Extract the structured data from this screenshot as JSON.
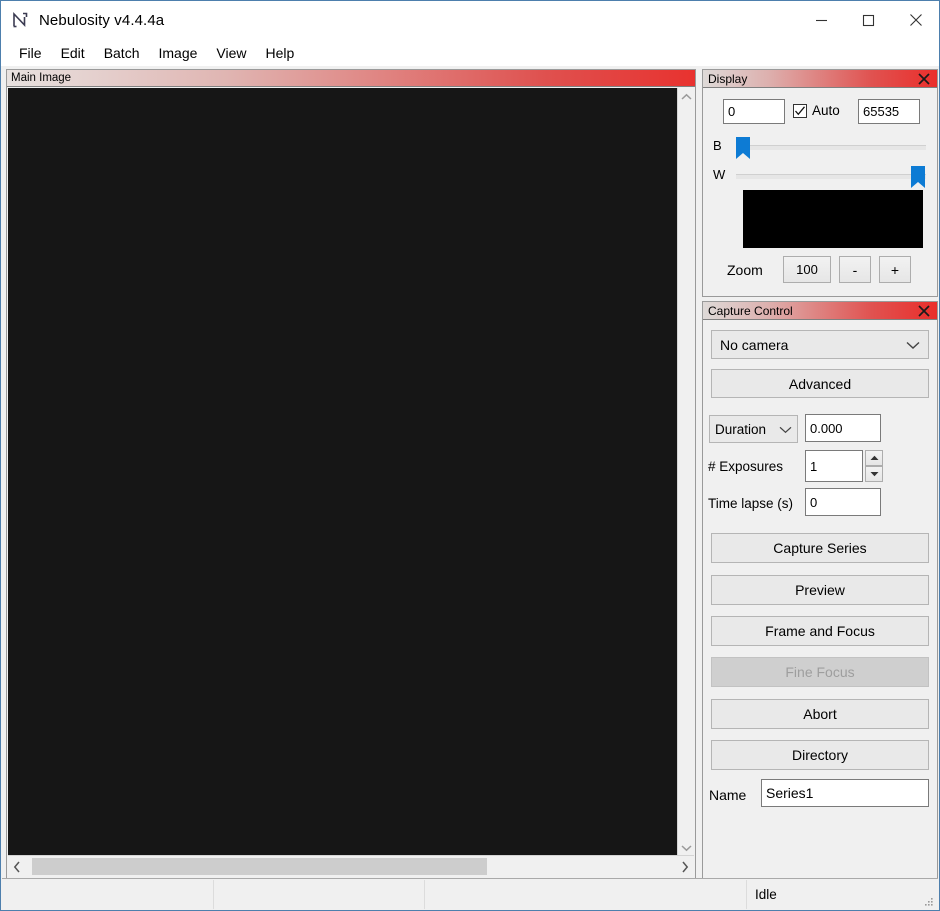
{
  "window": {
    "title": "Nebulosity v4.4.4a",
    "icon": "nebulosity-logo-icon",
    "minimize_label": "—",
    "maximize_label": "□",
    "close_label": "✕"
  },
  "menu": {
    "items": [
      {
        "label": "File"
      },
      {
        "label": "Edit"
      },
      {
        "label": "Batch"
      },
      {
        "label": "Image"
      },
      {
        "label": "View"
      },
      {
        "label": "Help"
      }
    ]
  },
  "main_image": {
    "caption": "Main Image",
    "canvas_color": "#161616",
    "vscroll_up": "⌃",
    "vscroll_down": "⌄",
    "hscroll_left": "‹",
    "hscroll_right": "›"
  },
  "display_panel": {
    "title": "Display",
    "close_label": "✕",
    "black_level": "0",
    "white_level": "65535",
    "auto_label": "Auto",
    "auto_checked": true,
    "black_slider_label": "B",
    "white_slider_label": "W",
    "black_slider_value": 0,
    "white_slider_value": 100,
    "preview_swatch_color": "#000000",
    "zoom_label": "Zoom",
    "zoom_value": "100",
    "zoom_minus_label": "-",
    "zoom_plus_label": "+"
  },
  "capture_panel": {
    "title": "Capture Control",
    "close_label": "✕",
    "camera_selected": "No camera",
    "advanced_label": "Advanced",
    "duration_selected": "Duration",
    "duration_value": "0.000",
    "exposures_label": "# Exposures",
    "exposures_value": "1",
    "timelapse_label": "Time lapse (s)",
    "timelapse_value": "0",
    "buttons": [
      {
        "label": "Capture Series",
        "enabled": true
      },
      {
        "label": "Preview",
        "enabled": true
      },
      {
        "label": "Frame and Focus",
        "enabled": true
      },
      {
        "label": "Fine Focus",
        "enabled": false
      },
      {
        "label": "Abort",
        "enabled": true
      },
      {
        "label": "Directory",
        "enabled": true
      }
    ],
    "name_label": "Name",
    "name_value": "Series1"
  },
  "status_bar": {
    "cell1": "",
    "cell2": "",
    "cell3": "",
    "cell4": "Idle"
  },
  "colors": {
    "caption_gradient_start": "#e8e2e0",
    "caption_gradient_end": "#e8322f",
    "slider_blue": "#0d7bd4",
    "window_border": "#4d7fad",
    "panel_bg": "#f0f0f0"
  }
}
